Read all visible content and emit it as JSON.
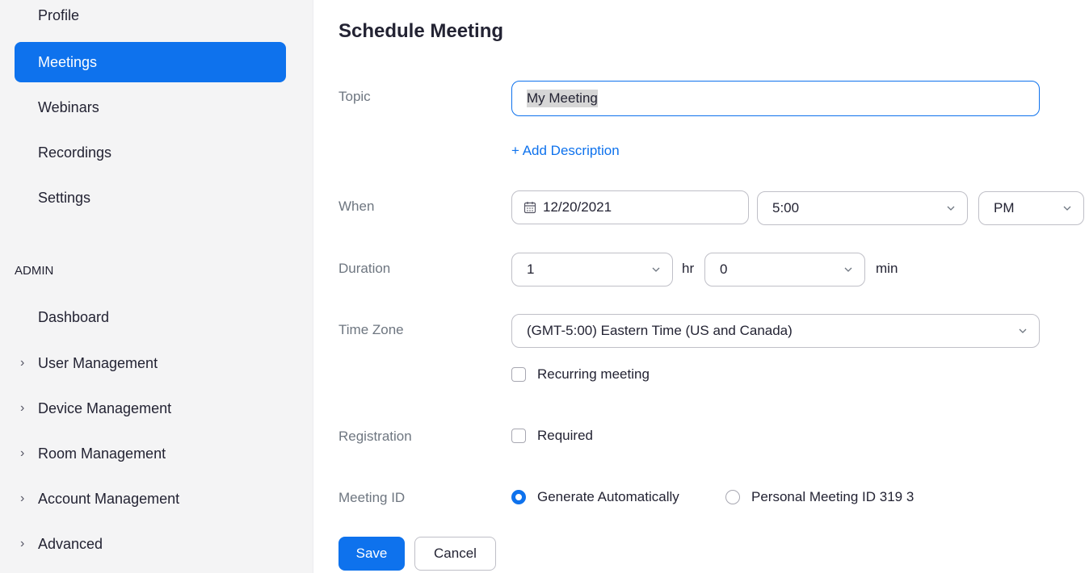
{
  "sidebar": {
    "personal_items": [
      {
        "label": "Profile"
      },
      {
        "label": "Meetings",
        "active": true
      },
      {
        "label": "Webinars"
      },
      {
        "label": "Recordings"
      },
      {
        "label": "Settings"
      }
    ],
    "admin_heading": "ADMIN",
    "admin_items": [
      {
        "label": "Dashboard"
      },
      {
        "label": "User Management",
        "expandable": true
      },
      {
        "label": "Device Management",
        "expandable": true
      },
      {
        "label": "Room Management",
        "expandable": true
      },
      {
        "label": "Account Management",
        "expandable": true
      },
      {
        "label": "Advanced",
        "expandable": true
      }
    ]
  },
  "form": {
    "title": "Schedule Meeting",
    "topic": {
      "label": "Topic",
      "value": "My Meeting"
    },
    "add_description": "+ Add Description",
    "when": {
      "label": "When",
      "date": "12/20/2021",
      "time": "5:00",
      "ampm": "PM"
    },
    "duration": {
      "label": "Duration",
      "hours": "1",
      "hours_unit": "hr",
      "minutes": "0",
      "minutes_unit": "min"
    },
    "time_zone": {
      "label": "Time Zone",
      "value": "(GMT-5:00) Eastern Time (US and Canada)"
    },
    "recurring": {
      "label": "Recurring meeting",
      "checked": false
    },
    "registration": {
      "label": "Registration",
      "option": "Required",
      "checked": false
    },
    "meeting_id": {
      "label": "Meeting ID",
      "options": [
        {
          "label": "Generate Automatically",
          "selected": true
        },
        {
          "label": "Personal Meeting ID 319 3",
          "selected": false
        }
      ]
    },
    "buttons": {
      "save": "Save",
      "cancel": "Cancel"
    }
  },
  "colors": {
    "accent": "#0e72ed",
    "label_gray": "#6e7680",
    "sidebar_bg": "#f4f4f5"
  }
}
